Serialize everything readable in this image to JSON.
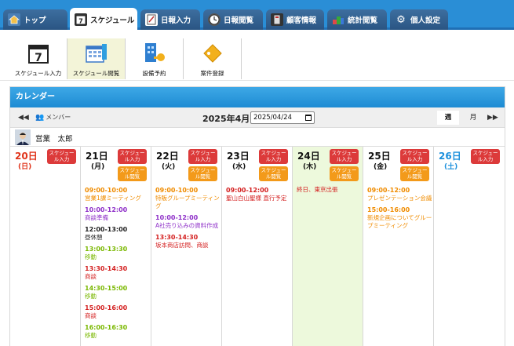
{
  "tabs": [
    {
      "label": "トップ",
      "icon": "house-icon"
    },
    {
      "label": "スケジュール",
      "icon": "calendar-icon"
    },
    {
      "label": "日報入力",
      "icon": "report-icon"
    },
    {
      "label": "日報閲覧",
      "icon": "clock-icon"
    },
    {
      "label": "顧客情報",
      "icon": "customer-icon"
    },
    {
      "label": "統計閲覧",
      "icon": "stats-icon"
    },
    {
      "label": "個人設定",
      "icon": "gear-icon"
    }
  ],
  "toolbar": [
    {
      "label": "スケジュール入力",
      "icon": "calendar-7-icon"
    },
    {
      "label": "スケジュール閲覧",
      "icon": "calendar-grid-icon"
    },
    {
      "label": "設備予約",
      "icon": "facility-key-icon"
    },
    {
      "label": "案件登録",
      "icon": "tag-icon"
    }
  ],
  "panel": {
    "title": "カレンダー"
  },
  "nav": {
    "member_label": "メンバー",
    "month": "2025年4月",
    "date_value": "2025/04/24",
    "view_week": "週",
    "view_month": "月"
  },
  "user": {
    "name": "営業　太郎"
  },
  "buttons": {
    "input": "スケジュール入力",
    "view": "スケジュール閲覧"
  },
  "colors": {
    "orange": "#f08c00",
    "red": "#d42020",
    "purple": "#8e2fc8",
    "green": "#7ab800",
    "black": "#222222",
    "input_button": "#dc3a3a",
    "view_button": "#f39a1a",
    "today_bg": "#edf9dc"
  },
  "days": [
    {
      "num": "20日",
      "dow": "(日)",
      "kind": "sun",
      "today": false,
      "has_view": false,
      "events": []
    },
    {
      "num": "21日",
      "dow": "(月)",
      "kind": "",
      "today": false,
      "has_view": true,
      "events": [
        {
          "time": "09:00-10:00",
          "desc": "営業1課ミーティング",
          "color": "orange"
        },
        {
          "time": "10:00-12:00",
          "desc": "商談準備",
          "color": "purple"
        },
        {
          "time": "12:00-13:00",
          "desc": "昼休憩",
          "color": "black"
        },
        {
          "time": "13:00-13:30",
          "desc": "移動",
          "color": "green"
        },
        {
          "time": "13:30-14:30",
          "desc": "商談",
          "color": "red"
        },
        {
          "time": "14:30-15:00",
          "desc": "移動",
          "color": "green"
        },
        {
          "time": "15:00-16:00",
          "desc": "商談",
          "color": "red"
        },
        {
          "time": "16:00-16:30",
          "desc": "移動",
          "color": "green"
        }
      ]
    },
    {
      "num": "22日",
      "dow": "(火)",
      "kind": "",
      "today": false,
      "has_view": true,
      "events": [
        {
          "time": "09:00-10:00",
          "desc": "特販グループミーティング",
          "color": "orange"
        },
        {
          "time": "10:00-12:00",
          "desc": "A社売り込みの資料作成",
          "color": "purple"
        },
        {
          "time": "13:30-14:30",
          "desc": "坂本商店訪問、商談",
          "color": "red"
        }
      ]
    },
    {
      "num": "23日",
      "dow": "(水)",
      "kind": "",
      "today": false,
      "has_view": true,
      "events": [
        {
          "time": "09:00-12:00",
          "desc": "聖山白山聖様 直行予定",
          "color": "red"
        }
      ]
    },
    {
      "num": "24日",
      "dow": "(木)",
      "kind": "",
      "today": true,
      "has_view": true,
      "events": [
        {
          "time": "",
          "desc": "終日、東京出張",
          "color": "red"
        }
      ]
    },
    {
      "num": "25日",
      "dow": "(金)",
      "kind": "",
      "today": false,
      "has_view": true,
      "events": [
        {
          "time": "09:00-12:00",
          "desc": "プレゼンテーション会議",
          "color": "orange"
        },
        {
          "time": "15:00-16:00",
          "desc": "新規企画についてグループミーティング",
          "color": "orange"
        }
      ]
    },
    {
      "num": "26日",
      "dow": "(土)",
      "kind": "sat",
      "today": false,
      "has_view": false,
      "events": []
    }
  ]
}
